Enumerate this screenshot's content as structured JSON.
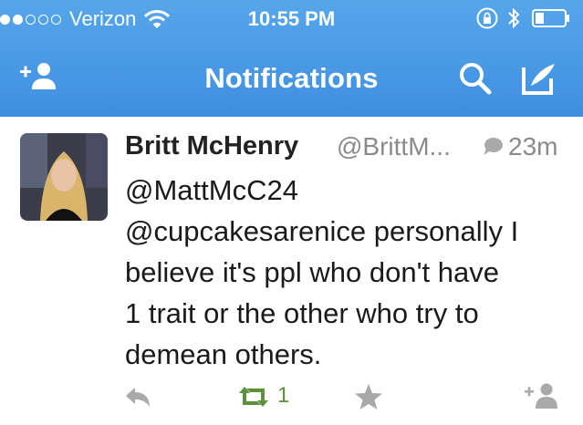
{
  "status_bar": {
    "carrier": "Verizon",
    "time": "10:55 PM",
    "signal_bars_filled": 2,
    "signal_bars_total": 5
  },
  "nav": {
    "title": "Notifications",
    "left_icon": "add-follow-icon",
    "right_icons": [
      "search-icon",
      "compose-icon"
    ]
  },
  "tweet": {
    "name": "Britt McHenry",
    "handle": "@BrittM...",
    "time_ago": "23m",
    "text_lines": [
      "@MattMcC24",
      "@cupcakesarenice personally I",
      "believe it's ppl who don't have",
      "1 trait or the other who try to",
      "demean others."
    ],
    "retweet_count": "1"
  },
  "colors": {
    "nav_bg": "#4a9be6",
    "retweet_green": "#5c913b",
    "muted_gray": "#8a8a8a",
    "icon_gray": "#a9a9a9"
  }
}
